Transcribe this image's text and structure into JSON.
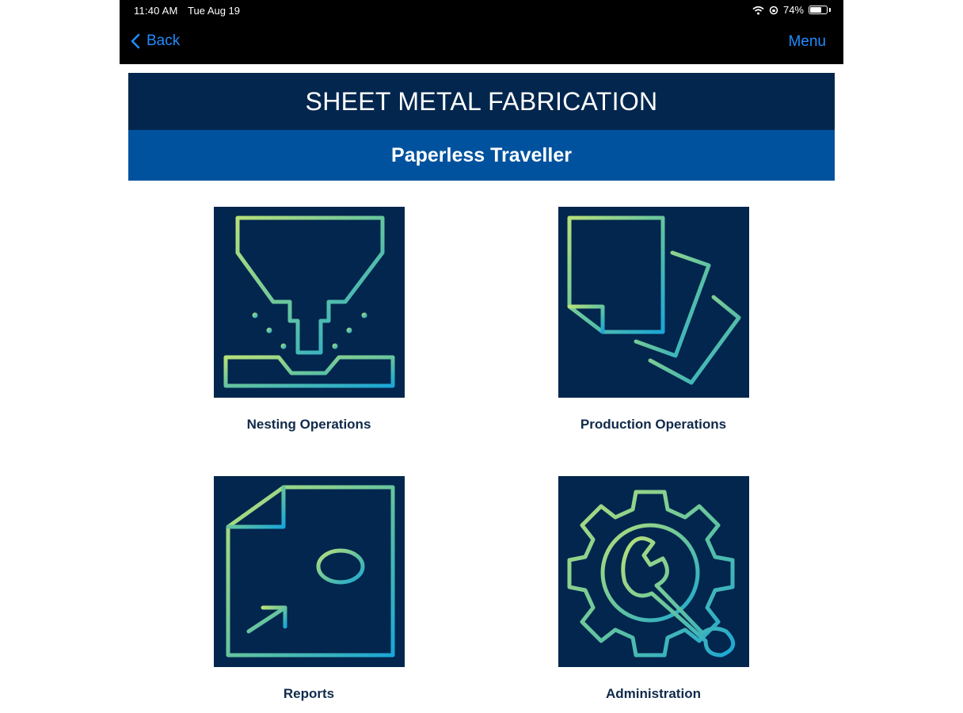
{
  "status_bar": {
    "time": "11:40 AM",
    "date": "Tue Aug 19",
    "battery": "74%",
    "battery_level": 0.74
  },
  "nav": {
    "back_label": "Back",
    "menu_label": "Menu"
  },
  "header": {
    "title": "SHEET METAL FABRICATION",
    "subtitle": "Paperless Traveller"
  },
  "tiles": [
    {
      "label": "Nesting Operations",
      "icon": "nesting-machine-icon"
    },
    {
      "label": "Production Operations",
      "icon": "documents-icon"
    },
    {
      "label": "Reports",
      "icon": "report-document-icon"
    },
    {
      "label": "Administration",
      "icon": "gear-wrench-icon"
    }
  ],
  "colors": {
    "title_bg": "#02264d",
    "subtitle_bg": "#00529e",
    "nav_link": "#1f8cff",
    "icon_gradient_start": "#b6e07a",
    "icon_gradient_end": "#1aa6d6"
  }
}
